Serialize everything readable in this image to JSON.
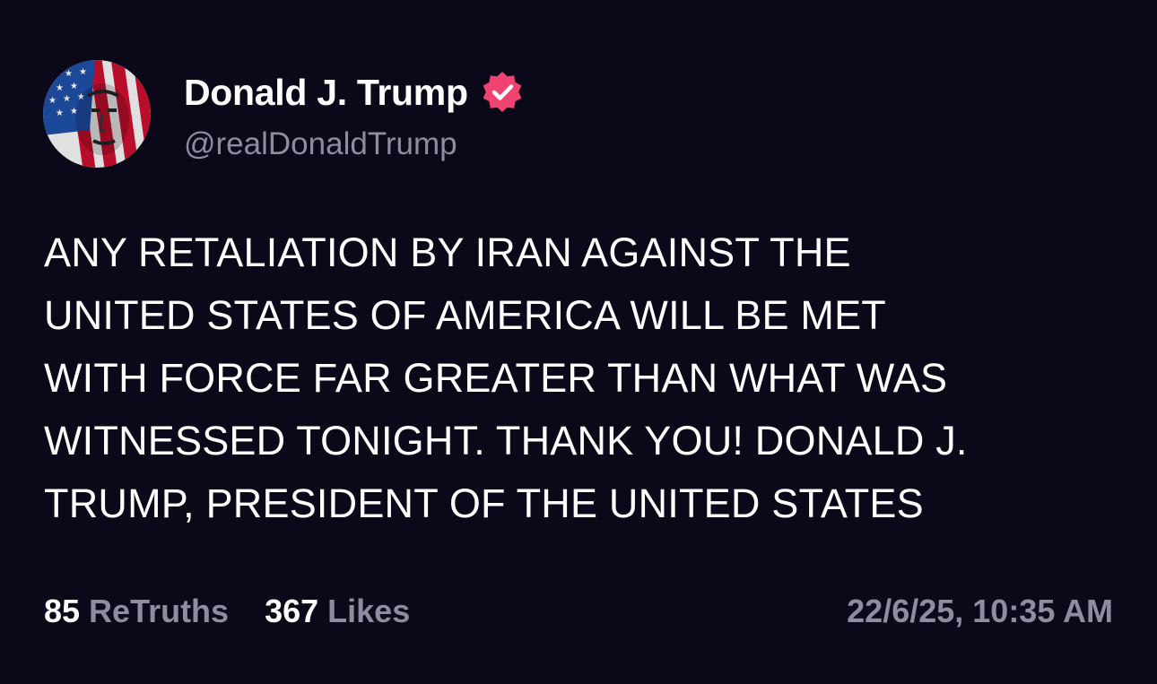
{
  "author": {
    "display_name": "Donald J. Trump",
    "handle": "@realDonaldTrump",
    "verified": true,
    "avatar_icon": "flag-portrait-avatar",
    "badge_icon": "verified-check-icon"
  },
  "post": {
    "lines": [
      "ANY RETALIATION BY IRAN AGAINST THE",
      "UNITED STATES OF AMERICA WILL BE MET",
      "WITH FORCE FAR GREATER THAN WHAT WAS",
      "WITNESSED TONIGHT. THANK YOU! DONALD J.",
      "TRUMP, PRESIDENT OF THE UNITED STATES"
    ]
  },
  "stats": {
    "retruths_count": "85",
    "retruths_label": "ReTruths",
    "likes_count": "367",
    "likes_label": "Likes"
  },
  "timestamp": "22/6/25, 10:35 AM",
  "colors": {
    "background": "#0b0819",
    "text": "#ffffff",
    "muted": "#8f8ba0",
    "badge": "#f0436f"
  }
}
